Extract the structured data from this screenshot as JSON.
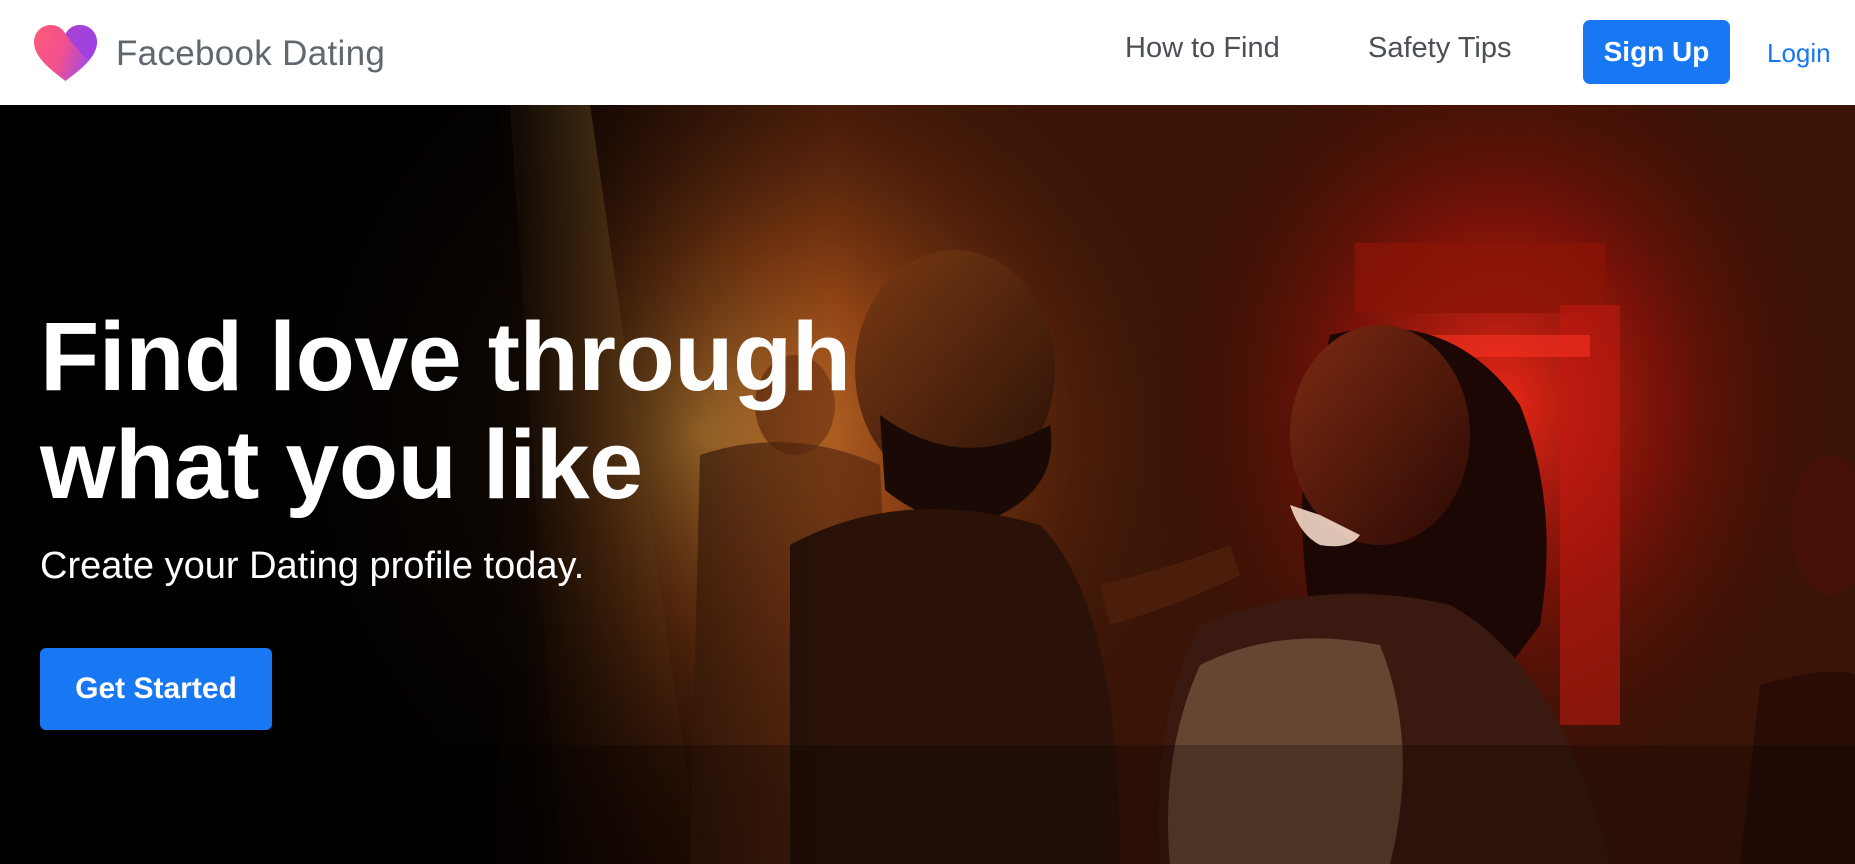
{
  "header": {
    "brand_name": "Facebook Dating",
    "logo_icon": "heart-logo-icon",
    "nav": {
      "how_to_find": "How to Find",
      "safety_tips": "Safety Tips"
    },
    "signup_label": "Sign Up",
    "login_label": "Login"
  },
  "hero": {
    "title_line1": "Find love through",
    "title_line2": "what you like",
    "subtitle": "Create your Dating profile today.",
    "cta_label": "Get Started",
    "photo_alt": "Couple dancing in a dimly lit venue"
  },
  "colors": {
    "accent": "#1877f2",
    "brand_text": "#606770",
    "heart_pink": "#f25a8b",
    "heart_purple": "#9b3fe0"
  }
}
